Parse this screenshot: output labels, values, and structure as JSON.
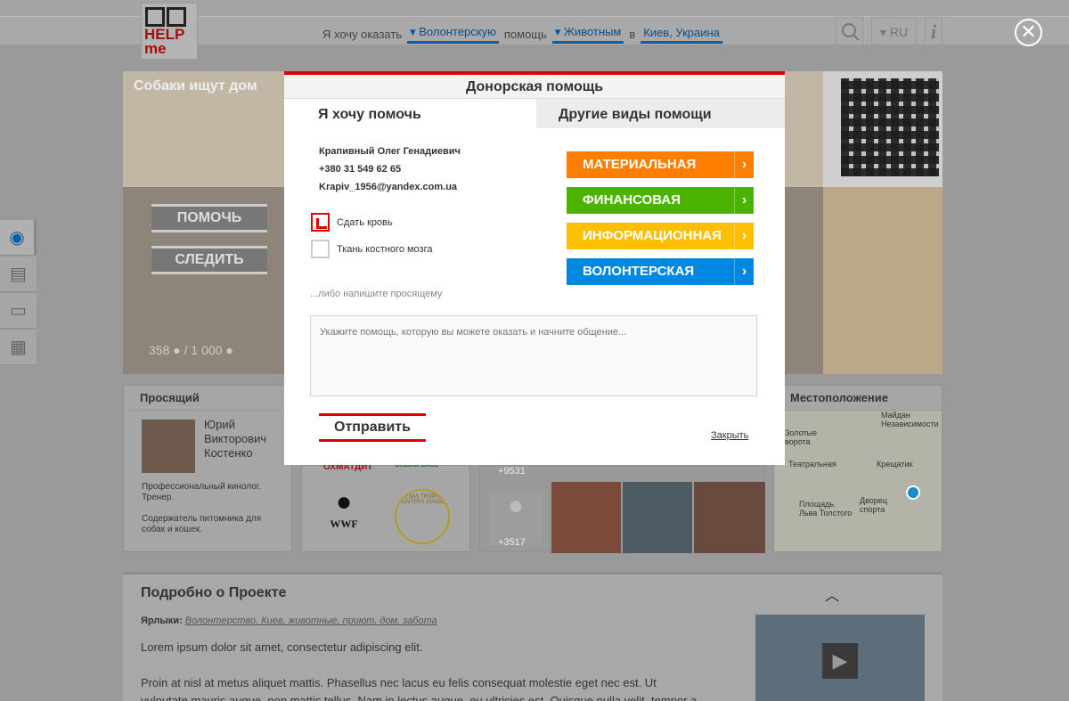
{
  "logo": {
    "text": "HELP\nme"
  },
  "header": {
    "filter_prefix": "Я хочу оказать",
    "filter_help_type": "Волонтерскую",
    "filter_mid": "помощь",
    "filter_target": "Животным",
    "filter_in": "в",
    "filter_location": "Киев, Украина",
    "lang": "RU"
  },
  "hero": {
    "title": "Собаки ищут дом",
    "help_button": "ПОМОЧЬ",
    "follow_button": "СЛЕДИТЬ",
    "count_current": "358",
    "count_total": "/ 1 000"
  },
  "requester": {
    "title": "Просящий",
    "name_first": "Юрий",
    "name_middle": "Викторович",
    "name_last": "Костенко",
    "desc1": "Профессиональный кинолог. Тренер.",
    "desc2": "Содержатель питомника для собак и кошек."
  },
  "partners": {
    "wwf": "WWF",
    "ohmatdyt": "ОХМАТДИТ",
    "greenpeace": "GREENPEACE",
    "texas": "TEXAS TROPHY HUNTERS ASSOC."
  },
  "followers": {
    "count1": "+9531",
    "count2": "+3517"
  },
  "location": {
    "title": "Местоположение",
    "m1": "Майдан Независимости",
    "m2": "Золотые ворота",
    "m3": "Театральная",
    "m4": "Крещатик",
    "m5": "Площадь Льва Толстого",
    "m6": "Дворец спорта"
  },
  "project": {
    "title": "Подробно о Проекте",
    "tags_label": "Ярлыки:",
    "tags": "Волонтерство, Киев, животные, приют, дом, забота",
    "p1": "Lorem ipsum dolor sit amet, consectetur adipiscing elit.",
    "p2": "Proin at nisl at metus aliquet mattis. Phasellus nec lacus eu felis consequat molestie eget nec est. Ut vulputate mauris augue, non mattis tellus. Nam in lectus augue, eu ultricies est. Quisque nulla velit, tempor a pel-"
  },
  "modal": {
    "title": "Донорская помощь",
    "tab_active": "Я хочу помочь",
    "tab_other": "Другие виды помощи",
    "contact_name": "Крапивный Олег Генадиевич",
    "contact_phone": "+380 31 549 62 65",
    "contact_email": "Krapiv_1956@yandex.com.ua",
    "option_blood": "Сдать кровь",
    "option_marrow": "Ткань костного мозга",
    "or_write": "...либо напишите просящему",
    "message_placeholder": "Укажите помощь, которую вы можете оказать и начните общение...",
    "send_button": "Отправить",
    "close_link": "Закрыть",
    "help_types": [
      {
        "label": "МАТЕРИАЛЬНАЯ",
        "color": "#ff7e00"
      },
      {
        "label": "ФИНАНСОВАЯ",
        "color": "#4cb400"
      },
      {
        "label": "ИНФОРМАЦИОННАЯ",
        "color": "#ffbf00"
      },
      {
        "label": "ВОЛОНТЕРСКАЯ",
        "color": "#0088e0"
      }
    ]
  },
  "colors": {
    "accent_red": "#e30000",
    "link_blue": "#0b5fa8"
  }
}
